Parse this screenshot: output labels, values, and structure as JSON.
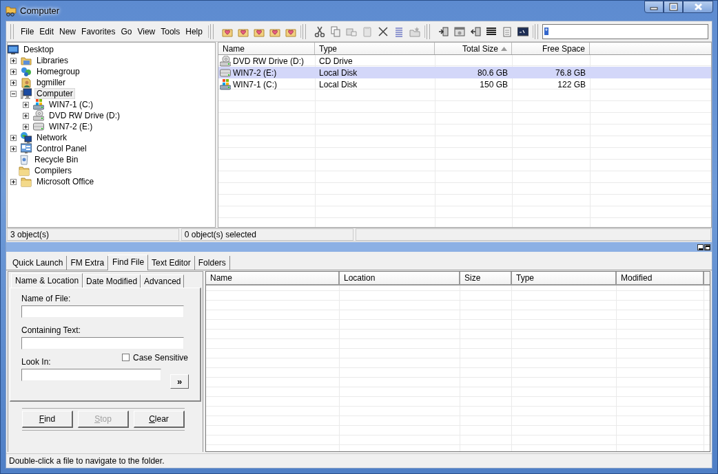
{
  "window": {
    "title": "Computer"
  },
  "menu": [
    "File",
    "Edit",
    "New",
    "Favorites",
    "Go",
    "View",
    "Tools",
    "Help"
  ],
  "search": {
    "value": "*"
  },
  "tree": [
    {
      "label": "Desktop",
      "kind": "desktop",
      "selected": false,
      "children": [
        {
          "label": "Libraries",
          "kind": "library",
          "expanded": false,
          "selected": false
        },
        {
          "label": "Homegroup",
          "kind": "homegroup",
          "expanded": false,
          "selected": false
        },
        {
          "label": "bgmiller",
          "kind": "user",
          "expanded": false,
          "selected": false
        },
        {
          "label": "Computer",
          "kind": "computer",
          "expanded": true,
          "selected": true,
          "children": [
            {
              "label": "WIN7-1 (C:)",
              "kind": "os-drive",
              "expanded": false,
              "selected": false
            },
            {
              "label": "DVD RW Drive (D:)",
              "kind": "dvd-drive",
              "expanded": false,
              "selected": false
            },
            {
              "label": "WIN7-2 (E:)",
              "kind": "drive",
              "expanded": false,
              "selected": false
            }
          ]
        },
        {
          "label": "Network",
          "kind": "network",
          "expanded": false,
          "selected": false
        },
        {
          "label": "Control Panel",
          "kind": "control-panel",
          "expanded": false,
          "selected": false
        },
        {
          "label": "Recycle Bin",
          "kind": "recycle-bin",
          "selected": false
        },
        {
          "label": "Compilers",
          "kind": "folder",
          "selected": false
        },
        {
          "label": "Microsoft Office",
          "kind": "folder",
          "expanded": false,
          "selected": false
        }
      ]
    }
  ],
  "file_list": {
    "columns": [
      {
        "label": "Name",
        "sorted": false
      },
      {
        "label": "Type",
        "sorted": false
      },
      {
        "label": "Total Size",
        "sorted": true
      },
      {
        "label": "Free Space",
        "sorted": false
      }
    ],
    "rows": [
      {
        "kind": "dvd-drive",
        "cells": [
          "DVD RW Drive (D:)",
          "CD Drive"
        ],
        "selected": false
      },
      {
        "kind": "drive",
        "cells": [
          "WIN7-2 (E:)",
          "Local Disk",
          "80.6 GB",
          "76.8 GB"
        ],
        "selected": true
      },
      {
        "kind": "os-drive",
        "cells": [
          "WIN7-1 (C:)",
          "Local Disk",
          "150 GB",
          "122 GB"
        ],
        "selected": false
      }
    ]
  },
  "status": [
    "3 object(s)",
    "0 object(s) selected"
  ],
  "tabs": [
    {
      "label": "Quick Launch",
      "selected": false
    },
    {
      "label": "FM Extra",
      "selected": false
    },
    {
      "label": "Find File",
      "selected": true
    },
    {
      "label": "Text Editor",
      "selected": false
    },
    {
      "label": "Folders",
      "selected": false
    }
  ],
  "find": {
    "tabs": [
      {
        "label": "Name & Location",
        "selected": true
      },
      {
        "label": "Date Modified",
        "selected": false
      },
      {
        "label": "Advanced",
        "selected": false
      }
    ],
    "name_label": "Name of File:",
    "text_label": "Containing Text:",
    "look_label": "Look In:",
    "case_sensitive": {
      "label": "Case Sensitive",
      "checked": false
    },
    "browse": "»",
    "buttons": [
      {
        "label": "Find",
        "disabled": false
      },
      {
        "label": "Stop",
        "disabled": true
      },
      {
        "label": "Clear",
        "disabled": false
      }
    ],
    "results_columns": [
      "Name",
      "Location",
      "Size",
      "Type",
      "Modified"
    ]
  },
  "status_bar": "Double-click a file to navigate to the folder."
}
